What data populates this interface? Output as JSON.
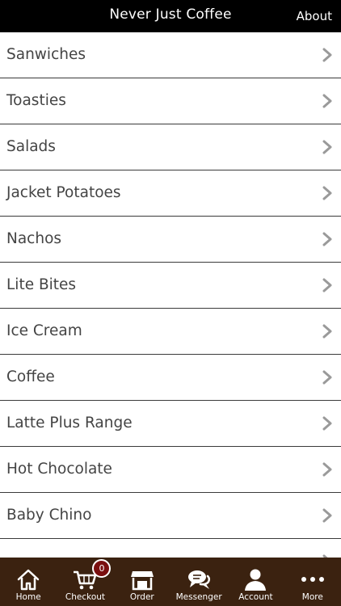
{
  "header": {
    "title": "Never Just Coffee",
    "about_label": "About"
  },
  "menu": [
    {
      "label": "Sanwiches"
    },
    {
      "label": "Toasties"
    },
    {
      "label": "Salads"
    },
    {
      "label": "Jacket Potatoes"
    },
    {
      "label": "Nachos"
    },
    {
      "label": "Lite Bites"
    },
    {
      "label": "Ice Cream"
    },
    {
      "label": "Coffee"
    },
    {
      "label": "Latte Plus Range"
    },
    {
      "label": "Hot Chocolate"
    },
    {
      "label": "Baby Chino"
    }
  ],
  "tabbar": {
    "home": "Home",
    "checkout": "Checkout",
    "checkout_count": "0",
    "order": "Order",
    "messenger": "Messenger",
    "account": "Account",
    "more": "More"
  },
  "colors": {
    "header_bg": "#000000",
    "tabbar_bg": "#3b2210",
    "badge_bg": "#7a0f0f",
    "chevron": "#9a9a9a"
  },
  "icons": [
    "home-icon",
    "cart-icon",
    "store-icon",
    "chat-icon",
    "person-icon",
    "more-dots-icon",
    "chevron-right-icon"
  ]
}
